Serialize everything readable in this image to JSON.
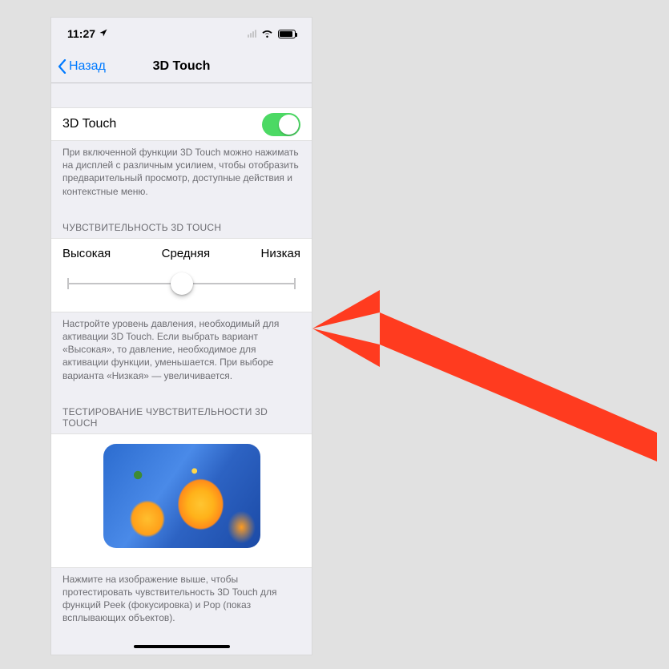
{
  "status": {
    "time": "11:27"
  },
  "nav": {
    "back_label": "Назад",
    "title": "3D Touch"
  },
  "toggle": {
    "label": "3D Touch",
    "on": true,
    "footer": "При включенной функции 3D Touch можно нажимать на дисплей с различным усилием, чтобы отобразить предварительный просмотр, доступные действия и контекстные меню."
  },
  "sensitivity": {
    "header": "ЧУВСТВИТЕЛЬНОСТЬ 3D TOUCH",
    "labels": {
      "high": "Высокая",
      "medium": "Средняя",
      "low": "Низкая"
    },
    "value": "medium",
    "footer": "Настройте уровень давления, необходимый для активации 3D Touch. Если выбрать вариант «Высокая», то давление, необходимое для активации функции, уменьшается. При выборе варианта «Низкая» — увеличивается."
  },
  "test": {
    "header": "ТЕСТИРОВАНИЕ ЧУВСТВИТЕЛЬНОСТИ 3D TOUCH",
    "footer": "Нажмите на изображение выше, чтобы протестировать чувствительность 3D Touch для функций Peek (фокусировка) и Pop (показ всплывающих объектов)."
  },
  "colors": {
    "accent": "#007aff",
    "switch_on": "#4cd964",
    "arrow": "#ff3b1f"
  }
}
